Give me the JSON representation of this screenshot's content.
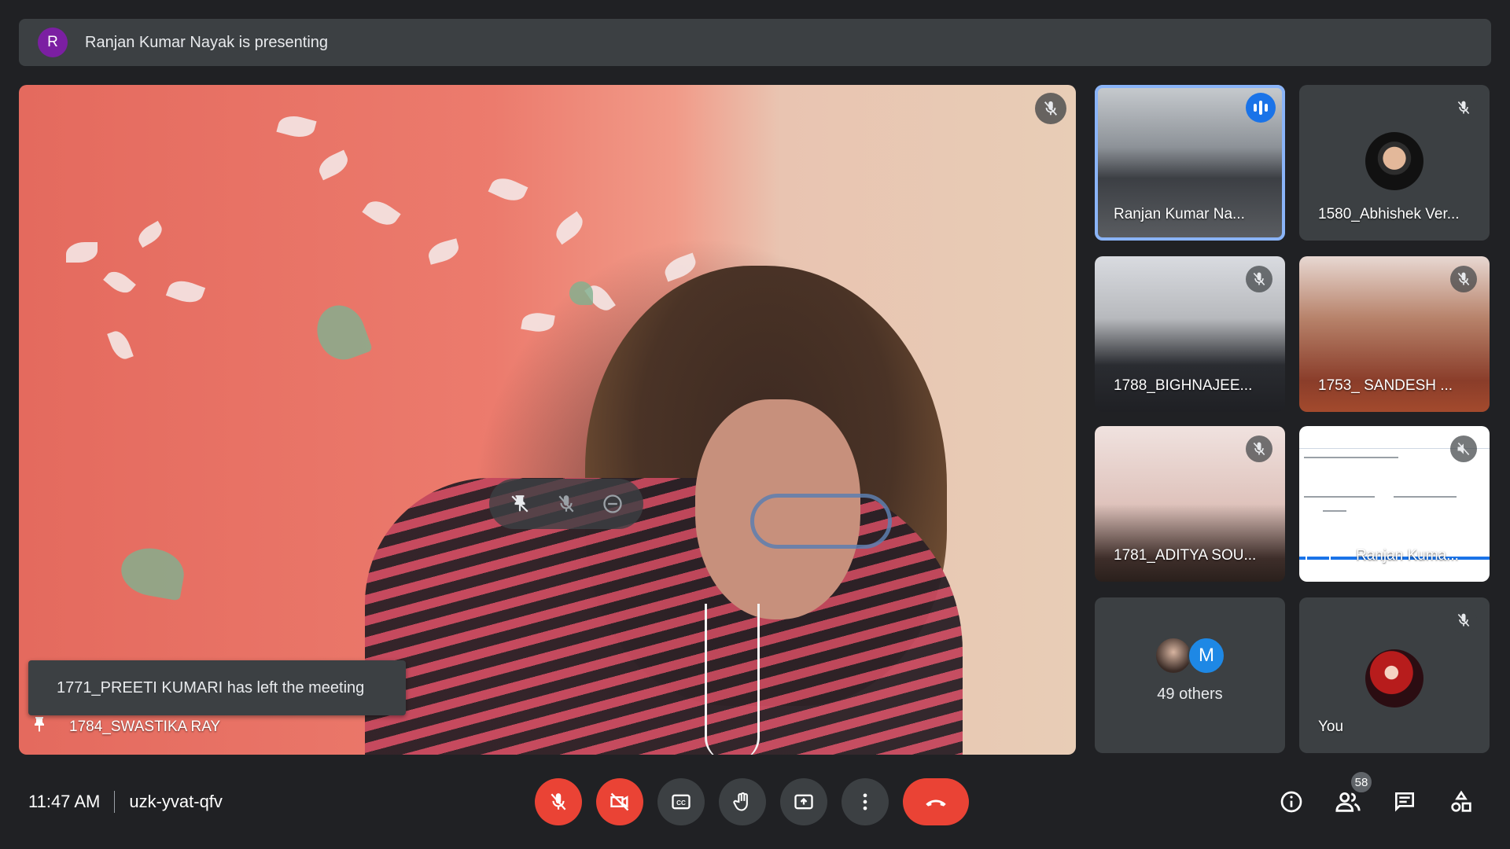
{
  "banner": {
    "avatar_letter": "R",
    "text": "Ranjan Kumar Nayak is presenting"
  },
  "stage": {
    "participant_name": "1784_SWASTIKA RAY",
    "toast": "1771_PREETI KUMARI has left the meeting",
    "mic_icon": "mic-off-icon",
    "hover_controls": [
      "unpin-icon",
      "mute-icon",
      "remove-icon"
    ]
  },
  "tiles": [
    {
      "name": "Ranjan Kumar Na...",
      "state": "speaking"
    },
    {
      "name": "1580_Abhishek Ver...",
      "state": "muted"
    },
    {
      "name": "1788_BIGHNAJEE...",
      "state": "muted"
    },
    {
      "name": "1753_ SANDESH ...",
      "state": "muted"
    },
    {
      "name": "1781_ADITYA SOU...",
      "state": "muted"
    },
    {
      "name": "Ranjan Kuma...",
      "state": "presentation"
    },
    {
      "name": "49 others",
      "avatar_letter": "M"
    },
    {
      "name": "You",
      "state": "muted"
    }
  ],
  "bottom": {
    "time": "11:47 AM",
    "meeting_code": "uzk-yvat-qfv",
    "participants_count": "58",
    "controls": [
      "mic-off-icon",
      "camera-off-icon",
      "captions-icon",
      "raise-hand-icon",
      "present-icon",
      "more-icon",
      "end-call-icon"
    ],
    "right_controls": [
      "info-icon",
      "people-icon",
      "chat-icon",
      "activities-icon"
    ]
  },
  "colors": {
    "accent": "#8ab4f8",
    "danger": "#ea4335",
    "surface": "#3c4043",
    "background": "#202124",
    "speaking": "#1a73e8"
  }
}
